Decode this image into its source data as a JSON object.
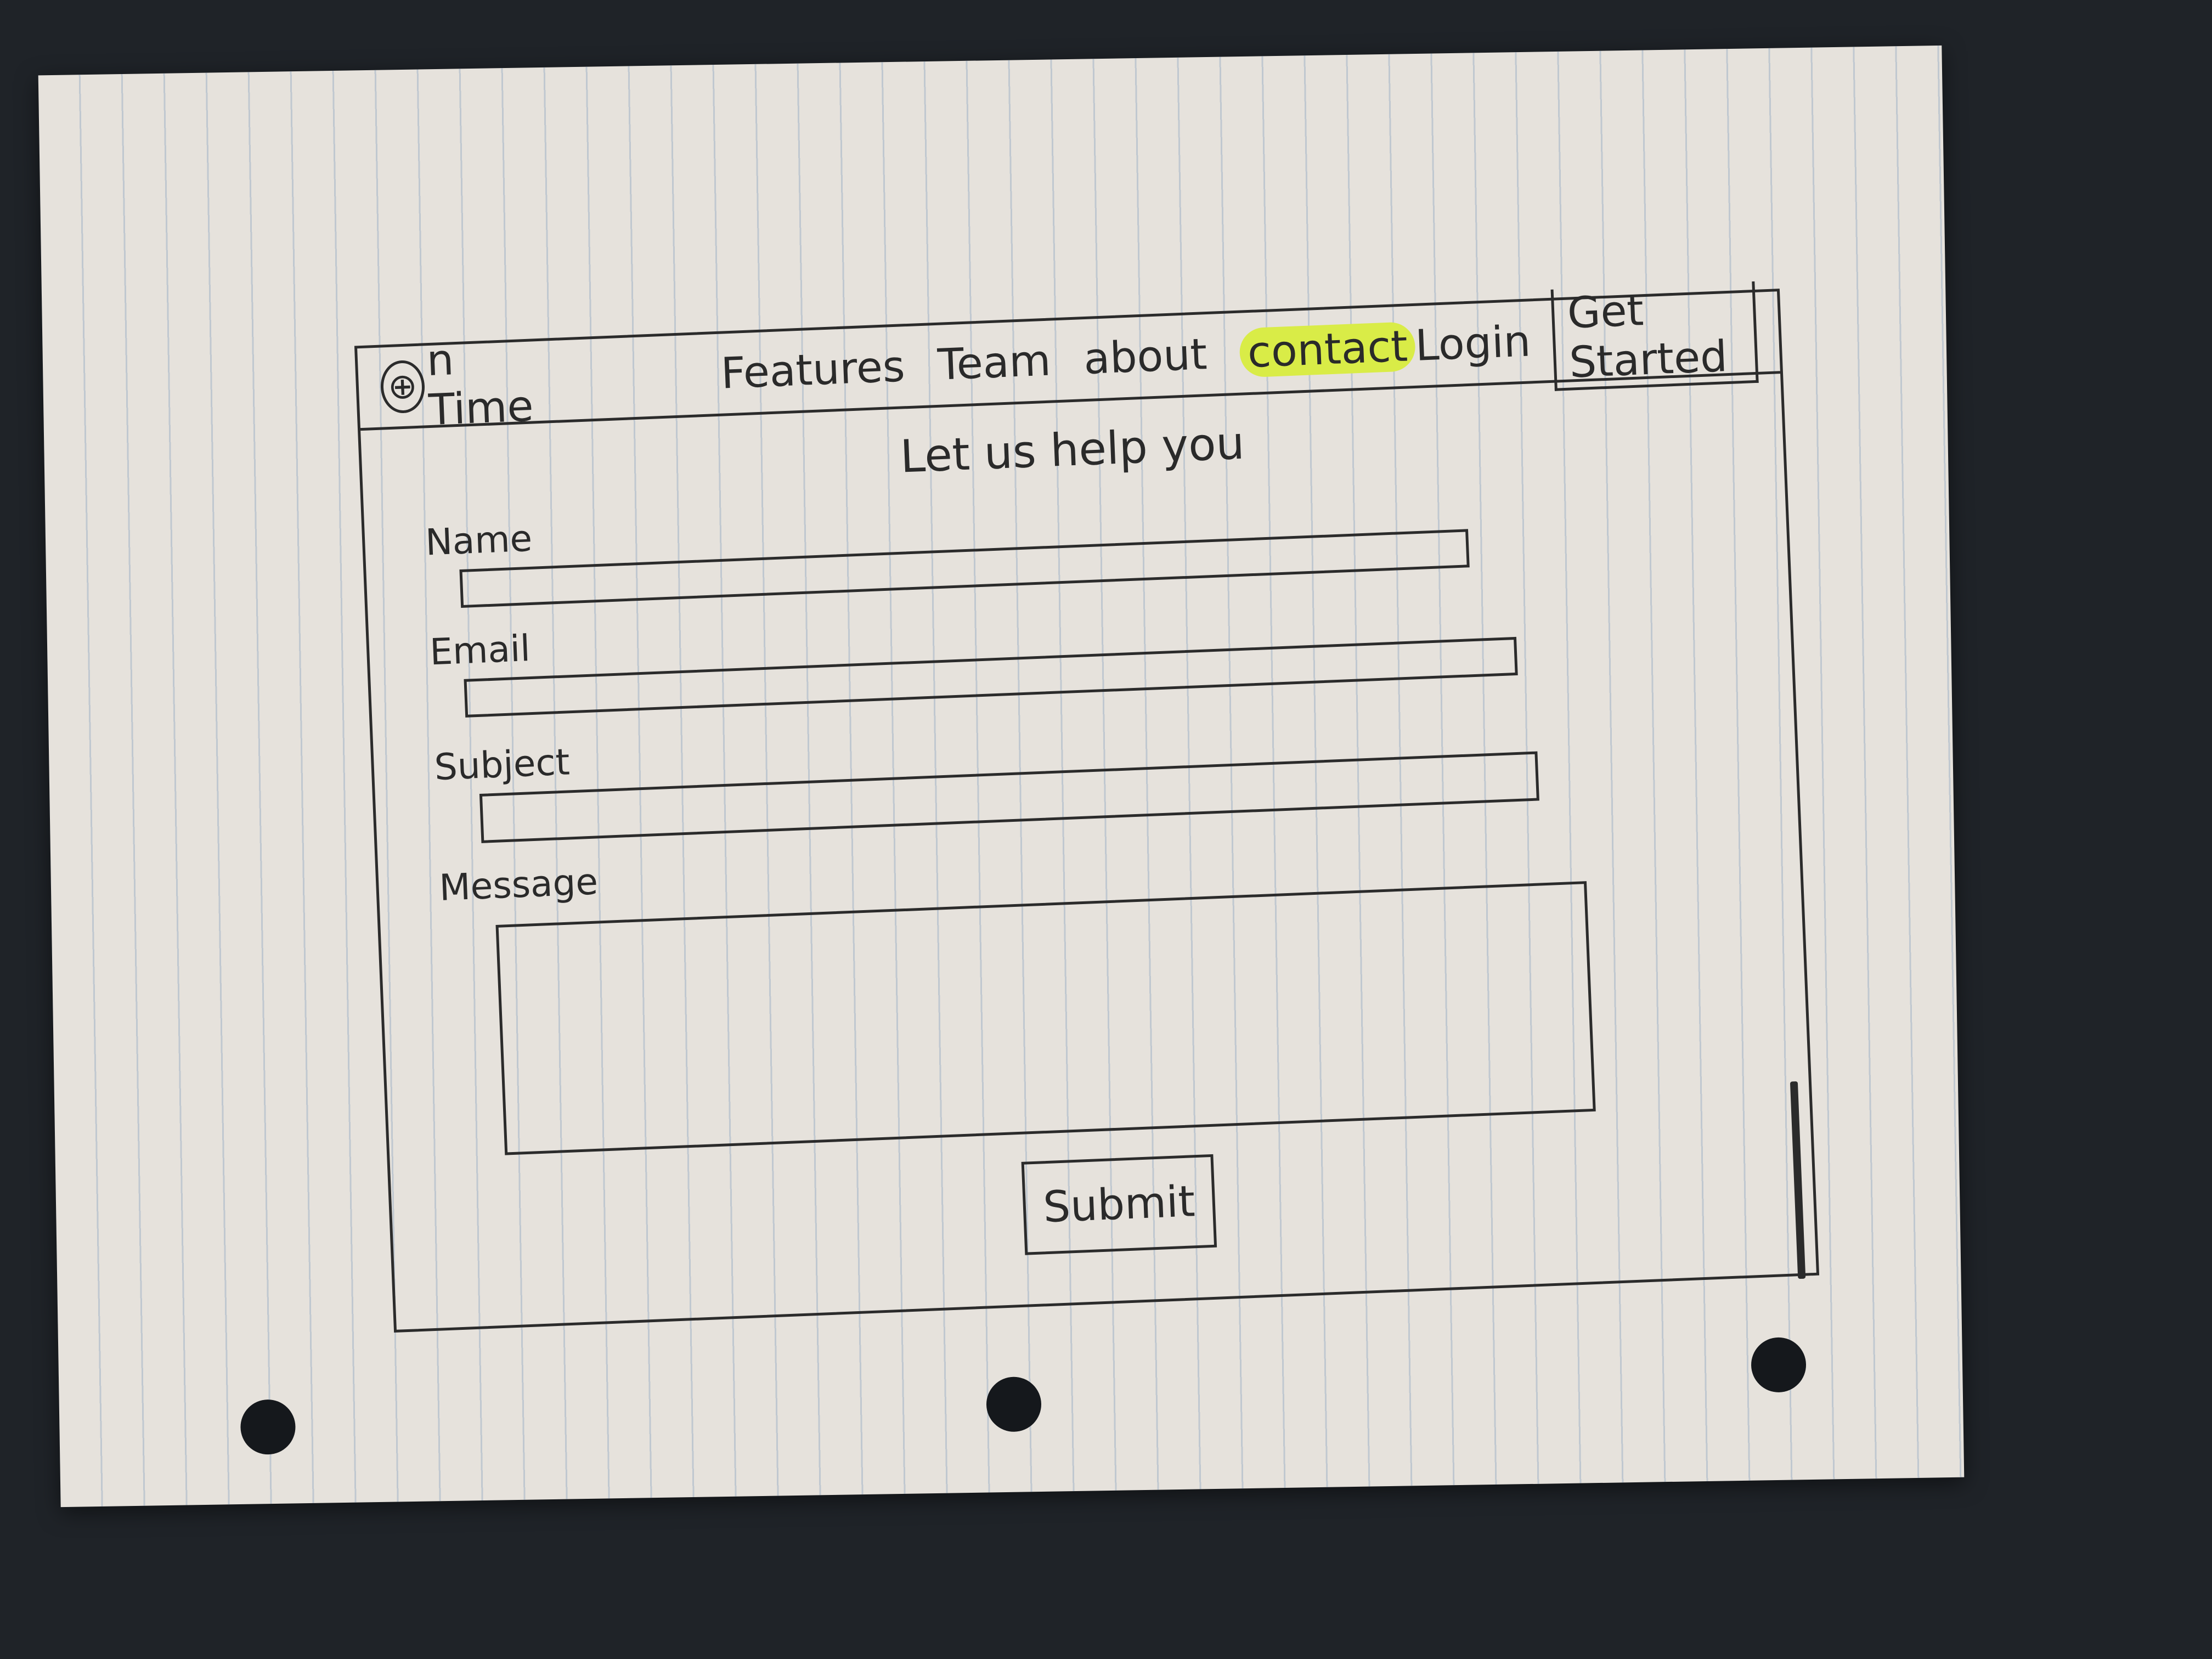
{
  "nav": {
    "logo_mark": "⊕",
    "logo_text": "n Time",
    "links": [
      "Features",
      "Team",
      "about",
      "contact"
    ],
    "login": "Login",
    "get_started": "Get Started"
  },
  "page": {
    "heading": "Let us help you"
  },
  "form": {
    "name_label": "Name",
    "email_label": "Email",
    "subject_label": "Subject",
    "message_label": "Message",
    "submit_label": "Submit"
  },
  "colors": {
    "highlight": "#d9ec47",
    "ink": "#2b2b2b"
  }
}
